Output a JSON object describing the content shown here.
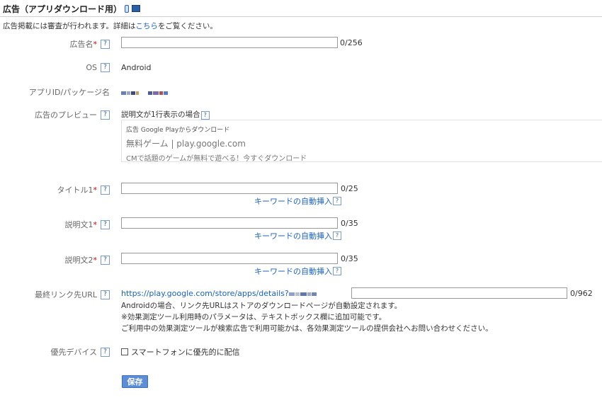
{
  "header": {
    "title": "広告（アプリダウンロード用）",
    "phone_icon": "smartphone-icon",
    "pc_icon": "pc-icon"
  },
  "notice": {
    "prefix": "広告掲載には審査が行われます。詳細は",
    "link": "こちら",
    "suffix": "をご覧ください。"
  },
  "help_glyph": "?",
  "required_mark": "*",
  "fields": {
    "ad_name": {
      "label": "広告名",
      "counter": "0/256",
      "value": ""
    },
    "os": {
      "label": "OS",
      "value": "Android"
    },
    "app_id": {
      "label": "アプリID/パッケージ名"
    },
    "preview": {
      "label": "広告のプレビュー",
      "caption": "説明文が1行表示の場合",
      "line1": "広告 Google Playからダウンロード",
      "line2": "無料ゲーム | play.google.com",
      "line3": "CMで話題のゲームが無料で遊べる！今すぐダウンロード"
    },
    "title1": {
      "label": "タイトル1",
      "counter": "0/25",
      "keyword": "キーワードの自動挿入"
    },
    "desc1": {
      "label": "説明文1",
      "counter": "0/35",
      "keyword": "キーワードの自動挿入"
    },
    "desc2": {
      "label": "説明文2",
      "counter": "0/35",
      "keyword": "キーワードの自動挿入"
    },
    "final_url": {
      "label": "最終リンク先URL",
      "prefix": "https://play.google.com/store/apps/details?",
      "counter": "0/962",
      "note1": "Androidの場合、リンク先URLはストアのダウンロードページが自動設定されます。",
      "note2": "※効果測定ツール利用時のパラメータは、テキストボックス欄に追加可能です。",
      "note3": "ご利用中の効果測定ツールが検索広告で利用可能かは、各効果測定ツールの提供会社へお問い合わせください。"
    },
    "device": {
      "label": "優先デバイス",
      "checkbox_label": "スマートフォンに優先的に配信",
      "checked": false
    }
  },
  "save_label": "保存",
  "colors": {
    "link": "#1a62c2",
    "required": "#dd0000",
    "button": "#5b8dd9"
  }
}
